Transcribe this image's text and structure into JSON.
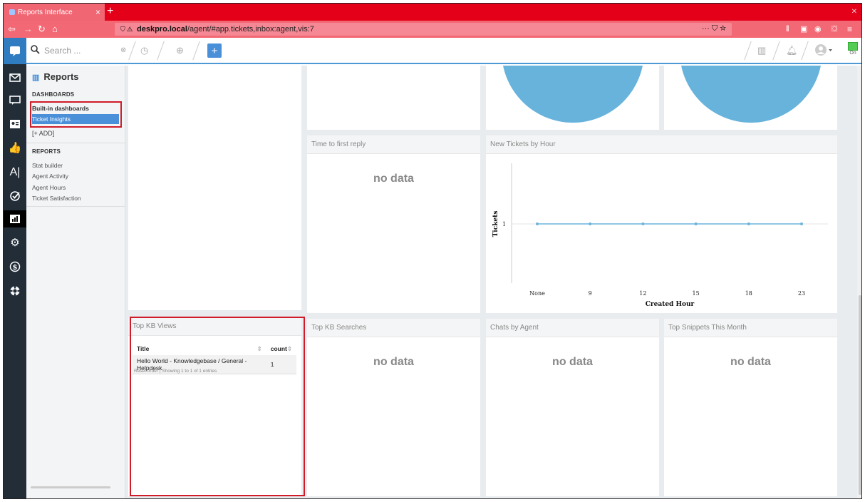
{
  "browser": {
    "tab_title": "Reports Interface",
    "tab_close": "×",
    "new_tab": "+",
    "url_host": "deskpro.local",
    "url_path": "/agent/#app.tickets,inbox:agent,vis:7",
    "url_icons": "··· ⛉ ☆"
  },
  "topbar": {
    "search_placeholder": "Search ...",
    "online_label": "On"
  },
  "sidebar": {
    "title": "Reports",
    "dashboards_heading": "DASHBOARDS",
    "dashboards": [
      {
        "label": "Built-in dashboards"
      },
      {
        "label": "Ticket Insights"
      }
    ],
    "add_label": "[+ ADD]",
    "reports_heading": "REPORTS",
    "reports": [
      {
        "label": "Stat builder"
      },
      {
        "label": "Agent Activity"
      },
      {
        "label": "Agent Hours"
      },
      {
        "label": "Ticket Satisfaction"
      }
    ]
  },
  "panels": {
    "time_to_first_reply": {
      "title": "Time to first reply",
      "empty": "no data"
    },
    "new_tickets_by_hour": {
      "title": "New Tickets by Hour"
    },
    "top_kb_views": {
      "title": "Top KB Views",
      "columns": [
        "Title",
        "count"
      ],
      "rows": [
        {
          "title": "Hello World - Knowledgebase / General - Helpdesk",
          "count": "1"
        }
      ],
      "footer": "Reset order | Showing 1 to 1 of 1 entries"
    },
    "top_kb_searches": {
      "title": "Top KB Searches",
      "empty": "no data"
    },
    "chats_by_agent": {
      "title": "Chats by Agent",
      "empty": "no data"
    },
    "top_snippets": {
      "title": "Top Snippets This Month",
      "empty": "no data"
    }
  },
  "chart_data": {
    "type": "line",
    "title": "New Tickets by Hour",
    "xlabel": "Created Hour",
    "ylabel": "Tickets",
    "x": [
      "None",
      "9",
      "12",
      "15",
      "18",
      "23"
    ],
    "series": [
      {
        "values": [
          1,
          1,
          1,
          1,
          1,
          1
        ]
      }
    ],
    "yticks": [
      "1"
    ],
    "color": "#6cb4dc",
    "grid": false
  },
  "colors": {
    "browser_chrome": "#e5001a",
    "accent": "#4a90d9",
    "pie": "#67b3dc",
    "highlight": "#d01c28"
  }
}
